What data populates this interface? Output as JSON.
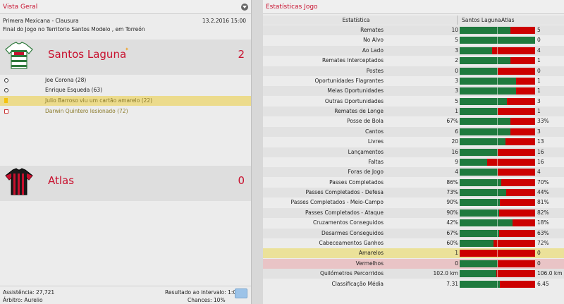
{
  "overview": {
    "title": "Vista Geral",
    "competition": "Primera Mexicana - Clausura",
    "datetime": "13.2.2016 15:00",
    "venue": "Final do Jogo no Territorio Santos Modelo , em Torreón",
    "home": {
      "name": "Santos Laguna",
      "score": "2"
    },
    "away": {
      "name": "Atlas",
      "score": "0"
    },
    "events": [
      {
        "text": "Joe Corona (28)",
        "type": "goal"
      },
      {
        "text": "Enrique Esqueda (63)",
        "type": "goal"
      },
      {
        "text": "Julio Barroso viu um cartão amarelo (22)",
        "type": "yellow"
      },
      {
        "text": "Darwin Quintero lesionado (72)",
        "type": "injury"
      }
    ],
    "footer": {
      "attendance": "Assistência: 27,721",
      "referee": "Árbitro: Aurelio",
      "halftime": "Resultado ao intervalo: 1:0",
      "chances": "Chances: 10%"
    }
  },
  "stats": {
    "title": "Estatísticas Jogo",
    "col_stat": "Estatística",
    "col_home": "Santos Laguna",
    "col_away": "Atlas",
    "rows": [
      {
        "label": "Remates",
        "home": "10",
        "away": "5",
        "share": 0.67
      },
      {
        "label": "No Alvo",
        "home": "5",
        "away": "0",
        "share": 1.0
      },
      {
        "label": "Ao Lado",
        "home": "3",
        "away": "4",
        "share": 0.43
      },
      {
        "label": "Remates Interceptados",
        "home": "2",
        "away": "1",
        "share": 0.67
      },
      {
        "label": "Postes",
        "home": "0",
        "away": "0",
        "share": 0.5
      },
      {
        "label": "Oportunidades Flagrantes",
        "home": "3",
        "away": "1",
        "share": 0.75
      },
      {
        "label": "Meias Oportunidades",
        "home": "3",
        "away": "1",
        "share": 0.75
      },
      {
        "label": "Outras Oportunidades",
        "home": "5",
        "away": "3",
        "share": 0.63
      },
      {
        "label": "Remates de Longe",
        "home": "1",
        "away": "1",
        "share": 0.5
      },
      {
        "label": "Posse de Bola",
        "home": "67%",
        "away": "33%",
        "share": 0.67
      },
      {
        "label": "Cantos",
        "home": "6",
        "away": "3",
        "share": 0.67
      },
      {
        "label": "Livres",
        "home": "20",
        "away": "13",
        "share": 0.61
      },
      {
        "label": "Lançamentos",
        "home": "16",
        "away": "16",
        "share": 0.5
      },
      {
        "label": "Faltas",
        "home": "9",
        "away": "16",
        "share": 0.36
      },
      {
        "label": "Foras de Jogo",
        "home": "4",
        "away": "4",
        "share": 0.5
      },
      {
        "label": "Passes Completados",
        "home": "86%",
        "away": "70%",
        "share": 0.55
      },
      {
        "label": "Passes Completados - Defesa",
        "home": "73%",
        "away": "44%",
        "share": 0.62
      },
      {
        "label": "Passes Completados - Meio-Campo",
        "home": "90%",
        "away": "81%",
        "share": 0.53
      },
      {
        "label": "Passes Completados - Ataque",
        "home": "90%",
        "away": "82%",
        "share": 0.52
      },
      {
        "label": "Cruzamentos Conseguidos",
        "home": "42%",
        "away": "18%",
        "share": 0.7
      },
      {
        "label": "Desarmes Conseguidos",
        "home": "67%",
        "away": "63%",
        "share": 0.52
      },
      {
        "label": "Cabeceamentos Ganhos",
        "home": "60%",
        "away": "72%",
        "share": 0.45
      },
      {
        "label": "Amarelos",
        "home": "1",
        "away": "0",
        "share": 0.0,
        "highlight": "yellow"
      },
      {
        "label": "Vermelhos",
        "home": "0",
        "away": "0",
        "share": 0.5,
        "highlight": "red"
      },
      {
        "label": "Quilómetros Percorridos",
        "home": "102.0 km",
        "away": "106.0 km",
        "share": 0.49
      },
      {
        "label": "Classificação Média",
        "home": "7.31",
        "away": "6.45",
        "share": 0.53
      }
    ]
  },
  "colors": {
    "accent": "#c8102e",
    "home_bar": "#1f7a3e",
    "away_bar": "#cc0000"
  }
}
